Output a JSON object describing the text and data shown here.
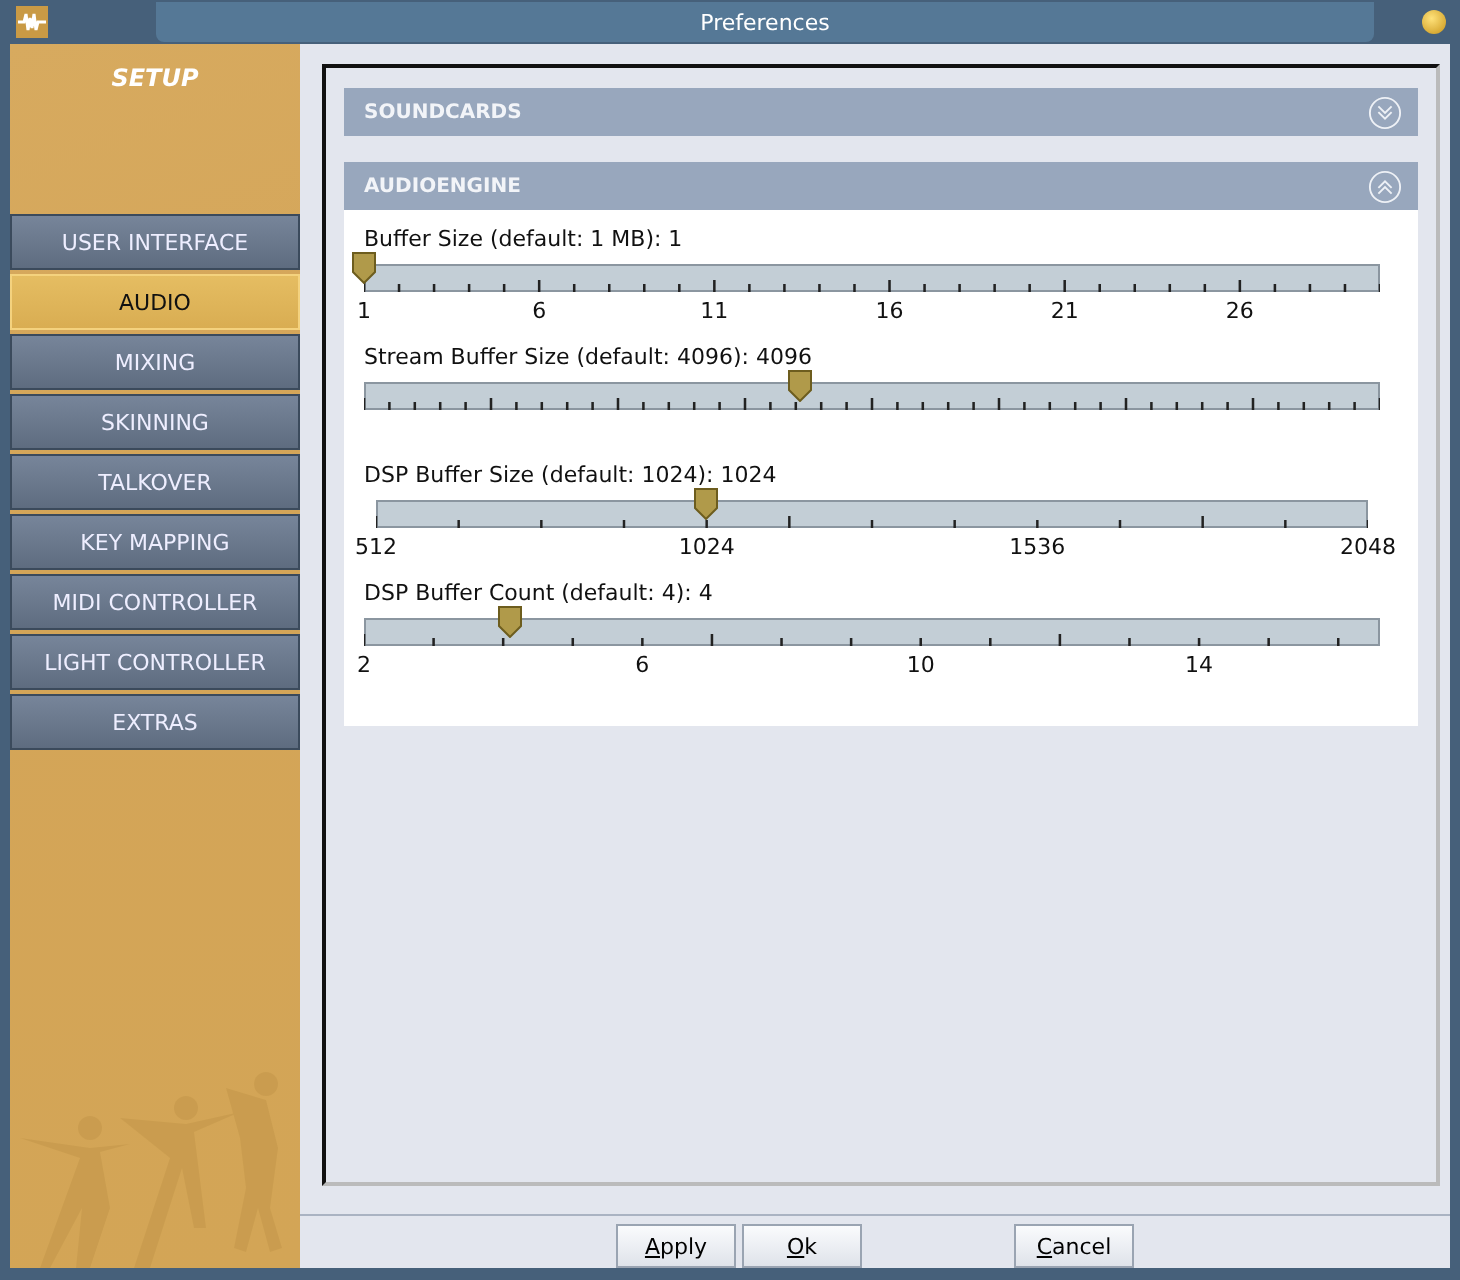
{
  "window": {
    "title": "Preferences"
  },
  "sidebar": {
    "title": "SETUP",
    "items": [
      {
        "label": "USER INTERFACE",
        "selected": false
      },
      {
        "label": "AUDIO",
        "selected": true
      },
      {
        "label": "MIXING",
        "selected": false
      },
      {
        "label": "SKINNING",
        "selected": false
      },
      {
        "label": "TALKOVER",
        "selected": false
      },
      {
        "label": "KEY MAPPING",
        "selected": false
      },
      {
        "label": "MIDI CONTROLLER",
        "selected": false
      },
      {
        "label": "LIGHT CONTROLLER",
        "selected": false
      },
      {
        "label": "EXTRAS",
        "selected": false
      }
    ]
  },
  "sections": [
    {
      "title": "SOUNDCARDS",
      "expanded": false
    },
    {
      "title": "AUDIOENGINE",
      "expanded": true,
      "sliders": [
        {
          "label": "Buffer Size (default: 1 MB): 1",
          "level": 0,
          "scale": [
            "1",
            "6",
            "11",
            "16",
            "21",
            "26"
          ]
        },
        {
          "label": "Stream Buffer Size (default: 4096): 4096",
          "level": 0.43
        },
        {
          "label": "DSP Buffer Size (default: 1024): 1024",
          "level": 0.333,
          "scale": [
            "512",
            "1024",
            "1536",
            "2048"
          ]
        },
        {
          "label": "DSP Buffer Count (default: 4): 4",
          "level": 0.143,
          "scale": [
            "2",
            "6",
            "10",
            "14"
          ]
        }
      ]
    }
  ],
  "buttons": [
    "Apply",
    "Ok",
    "Cancel"
  ]
}
